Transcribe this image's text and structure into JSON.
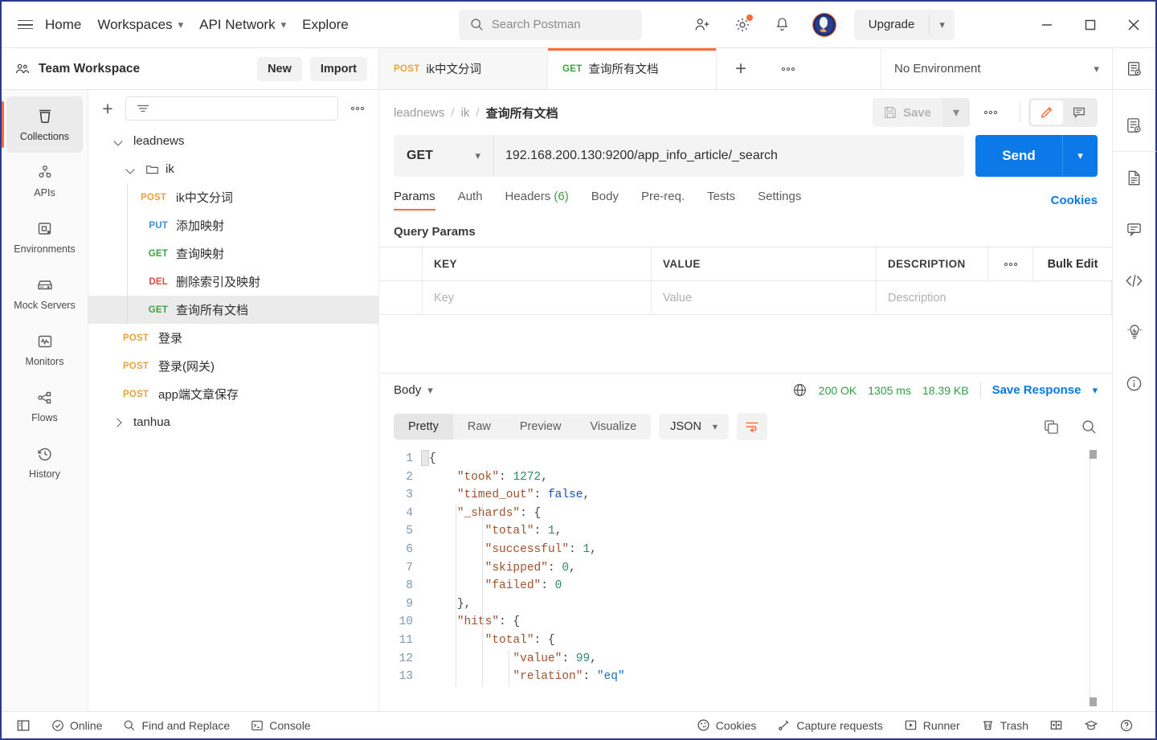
{
  "topbar": {
    "menu": [
      {
        "label": "Home",
        "caret": false
      },
      {
        "label": "Workspaces",
        "caret": true
      },
      {
        "label": "API Network",
        "caret": true
      },
      {
        "label": "Explore",
        "caret": false
      }
    ],
    "search_placeholder": "Search Postman",
    "upgrade_label": "Upgrade",
    "icons": [
      "hamburger-icon",
      "invite-user-icon",
      "settings-gear-icon",
      "notifications-bell-icon",
      "postman-account-avatar"
    ],
    "window_controls": [
      "minimize-icon",
      "maximize-icon",
      "close-icon"
    ]
  },
  "workspace": {
    "name": "Team Workspace",
    "new_label": "New",
    "import_label": "Import"
  },
  "tabs": [
    {
      "method": "POST",
      "title": "ik中文分词",
      "active": false,
      "method_class": "m-post"
    },
    {
      "method": "GET",
      "title": "查询所有文档",
      "active": true,
      "method_class": "m-get"
    }
  ],
  "environment": {
    "selected": "No Environment"
  },
  "sidebar_rail": [
    {
      "label": "Collections",
      "icon": "collections-icon",
      "active": true
    },
    {
      "label": "APIs",
      "icon": "apis-icon",
      "active": false
    },
    {
      "label": "Environments",
      "icon": "environments-icon",
      "active": false
    },
    {
      "label": "Mock Servers",
      "icon": "mock-servers-icon",
      "active": false
    },
    {
      "label": "Monitors",
      "icon": "monitors-icon",
      "active": false
    },
    {
      "label": "Flows",
      "icon": "flows-icon",
      "active": false
    },
    {
      "label": "History",
      "icon": "history-icon",
      "active": false
    }
  ],
  "collections": {
    "filter_placeholder": "",
    "tree": [
      {
        "type": "collection",
        "name": "leadnews",
        "expanded": true,
        "depth": 0
      },
      {
        "type": "folder",
        "name": "ik",
        "expanded": true,
        "depth": 1
      },
      {
        "type": "request",
        "method": "POST",
        "name": "ik中文分词",
        "depth": 2,
        "method_class": "m-post",
        "selected": false
      },
      {
        "type": "request",
        "method": "PUT",
        "name": "添加映射",
        "depth": 2,
        "method_class": "m-put",
        "selected": false
      },
      {
        "type": "request",
        "method": "GET",
        "name": "查询映射",
        "depth": 2,
        "method_class": "m-get",
        "selected": false
      },
      {
        "type": "request",
        "method": "DEL",
        "name": "删除索引及映射",
        "depth": 2,
        "method_class": "m-del",
        "selected": false
      },
      {
        "type": "request",
        "method": "GET",
        "name": "查询所有文档",
        "depth": 2,
        "method_class": "m-get",
        "selected": true
      },
      {
        "type": "request",
        "method": "POST",
        "name": "登录",
        "depth": 1,
        "method_class": "m-post",
        "selected": false
      },
      {
        "type": "request",
        "method": "POST",
        "name": "登录(网关)",
        "depth": 1,
        "method_class": "m-post",
        "selected": false
      },
      {
        "type": "request",
        "method": "POST",
        "name": "app端文章保存",
        "depth": 1,
        "method_class": "m-post",
        "selected": false
      },
      {
        "type": "collection",
        "name": "tanhua",
        "expanded": false,
        "depth": 0
      }
    ]
  },
  "request": {
    "breadcrumb": [
      "leadnews",
      "ik",
      "查询所有文档"
    ],
    "save_label": "Save",
    "method": "GET",
    "url": "192.168.200.130:9200/app_info_article/_search",
    "send_label": "Send",
    "tabs": [
      {
        "label": "Params",
        "active": true,
        "count": ""
      },
      {
        "label": "Auth",
        "active": false,
        "count": ""
      },
      {
        "label": "Headers",
        "active": false,
        "count": "(6)"
      },
      {
        "label": "Body",
        "active": false,
        "count": ""
      },
      {
        "label": "Pre-req.",
        "active": false,
        "count": ""
      },
      {
        "label": "Tests",
        "active": false,
        "count": ""
      },
      {
        "label": "Settings",
        "active": false,
        "count": ""
      }
    ],
    "cookies_link": "Cookies",
    "query_params": {
      "title": "Query Params",
      "headers": [
        "KEY",
        "VALUE",
        "DESCRIPTION"
      ],
      "bulk_edit_label": "Bulk Edit",
      "empty_row": {
        "key": "Key",
        "value": "Value",
        "description": "Description"
      }
    }
  },
  "response": {
    "body_label": "Body",
    "status": "200 OK",
    "time": "1305 ms",
    "size": "18.39 KB",
    "save_response_label": "Save Response",
    "view_tabs": [
      {
        "label": "Pretty",
        "active": true
      },
      {
        "label": "Raw",
        "active": false
      },
      {
        "label": "Preview",
        "active": false
      },
      {
        "label": "Visualize",
        "active": false
      }
    ],
    "format": "JSON",
    "lines": [
      {
        "n": 1,
        "indent": 0,
        "html": "<span class=\"punc\">{</span>"
      },
      {
        "n": 2,
        "indent": 1,
        "html": "<span class=\"k\">\"took\"</span><span class=\"punc\">: </span><span class=\"num\">1272</span><span class=\"punc\">,</span>"
      },
      {
        "n": 3,
        "indent": 1,
        "html": "<span class=\"k\">\"timed_out\"</span><span class=\"punc\">: </span><span class=\"bool\">false</span><span class=\"punc\">,</span>"
      },
      {
        "n": 4,
        "indent": 1,
        "html": "<span class=\"k\">\"_shards\"</span><span class=\"punc\">: {</span>"
      },
      {
        "n": 5,
        "indent": 2,
        "html": "<span class=\"k\">\"total\"</span><span class=\"punc\">: </span><span class=\"num\">1</span><span class=\"punc\">,</span>"
      },
      {
        "n": 6,
        "indent": 2,
        "html": "<span class=\"k\">\"successful\"</span><span class=\"punc\">: </span><span class=\"num\">1</span><span class=\"punc\">,</span>"
      },
      {
        "n": 7,
        "indent": 2,
        "html": "<span class=\"k\">\"skipped\"</span><span class=\"punc\">: </span><span class=\"num\">0</span><span class=\"punc\">,</span>"
      },
      {
        "n": 8,
        "indent": 2,
        "html": "<span class=\"k\">\"failed\"</span><span class=\"punc\">: </span><span class=\"num\">0</span>"
      },
      {
        "n": 9,
        "indent": 1,
        "html": "<span class=\"punc\">},</span>"
      },
      {
        "n": 10,
        "indent": 1,
        "html": "<span class=\"k\">\"hits\"</span><span class=\"punc\">: {</span>"
      },
      {
        "n": 11,
        "indent": 2,
        "html": "<span class=\"k\">\"total\"</span><span class=\"punc\">: {</span>"
      },
      {
        "n": 12,
        "indent": 3,
        "html": "<span class=\"k\">\"value\"</span><span class=\"punc\">: </span><span class=\"num\">99</span><span class=\"punc\">,</span>"
      },
      {
        "n": 13,
        "indent": 3,
        "html": "<span class=\"k\">\"relation\"</span><span class=\"punc\">: </span><span class=\"str\">\"eq\"</span>"
      }
    ]
  },
  "right_rail": [
    {
      "icon": "environment-quick-look-icon"
    },
    {
      "icon": "documentation-icon"
    },
    {
      "icon": "comments-icon"
    },
    {
      "icon": "code-snippet-icon"
    },
    {
      "icon": "info-lightbulb-icon"
    },
    {
      "icon": "info-circle-icon"
    }
  ],
  "statusbar": {
    "left": [
      {
        "label": "",
        "icon": "sidebar-toggle-icon"
      },
      {
        "label": "Online",
        "icon": "online-status-icon"
      },
      {
        "label": "Find and Replace",
        "icon": "search-icon"
      },
      {
        "label": "Console",
        "icon": "console-icon"
      }
    ],
    "right": [
      {
        "label": "Cookies",
        "icon": "cookie-icon"
      },
      {
        "label": "Capture requests",
        "icon": "capture-requests-icon"
      },
      {
        "label": "Runner",
        "icon": "runner-icon"
      },
      {
        "label": "Trash",
        "icon": "trash-icon"
      },
      {
        "label": "",
        "icon": "two-pane-layout-icon"
      },
      {
        "label": "",
        "icon": "learning-center-icon"
      },
      {
        "label": "",
        "icon": "help-icon"
      }
    ]
  },
  "colors": {
    "accent": "#ff6c37",
    "link": "#0b79e8",
    "success": "#2f9e44",
    "get": "#3fa142",
    "post": "#e8a33d",
    "put": "#3b8fd6",
    "delete": "#e04a3f"
  }
}
